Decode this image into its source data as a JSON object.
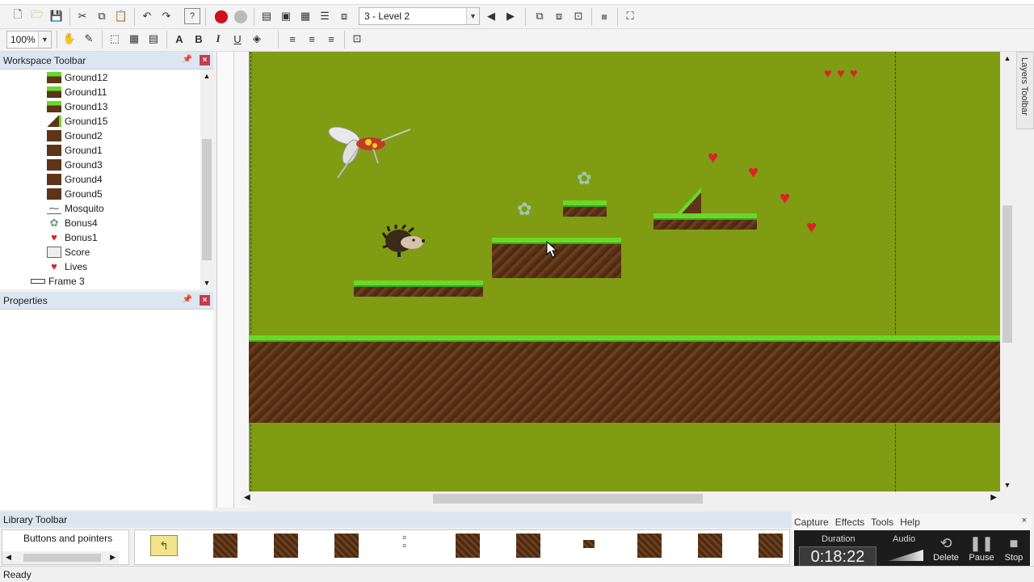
{
  "toolbar": {
    "level_select": "3 - Level 2",
    "zoom": "100%"
  },
  "workspace": {
    "title": "Workspace Toolbar",
    "items": [
      {
        "label": "Ground12",
        "icon": "ground-grass-icon"
      },
      {
        "label": "Ground11",
        "icon": "ground-grass-icon"
      },
      {
        "label": "Ground13",
        "icon": "ground-grass-icon"
      },
      {
        "label": "Ground15",
        "icon": "ground-slope-icon"
      },
      {
        "label": "Ground2",
        "icon": "ground-dirt-icon"
      },
      {
        "label": "Ground1",
        "icon": "ground-dirt-icon"
      },
      {
        "label": "Ground3",
        "icon": "ground-dirt-icon"
      },
      {
        "label": "Ground4",
        "icon": "ground-dirt-icon"
      },
      {
        "label": "Ground5",
        "icon": "ground-dirt-icon"
      },
      {
        "label": "Mosquito",
        "icon": "mosquito-icon"
      },
      {
        "label": "Bonus4",
        "icon": "flower-icon"
      },
      {
        "label": "Bonus1",
        "icon": "heart-icon"
      },
      {
        "label": "Score",
        "icon": "score-icon"
      },
      {
        "label": "Lives",
        "icon": "heart-icon"
      }
    ],
    "frame": "Frame 3"
  },
  "properties": {
    "title": "Properties"
  },
  "layers": {
    "title": "Layers Toolbar"
  },
  "library": {
    "title": "Library Toolbar",
    "tree_item": "Buttons and pointers"
  },
  "recorder": {
    "menu": [
      "Capture",
      "Effects",
      "Tools",
      "Help"
    ],
    "duration_label": "Duration",
    "duration": "0:18:22",
    "audio_label": "Audio",
    "delete": "Delete",
    "pause": "Pause",
    "stop": "Stop"
  },
  "status": {
    "text": "Ready"
  },
  "colors": {
    "canvas": "#7f9c13",
    "grass": "#6ad82a",
    "dirt": "#5d3518",
    "heart": "#e0202c"
  }
}
